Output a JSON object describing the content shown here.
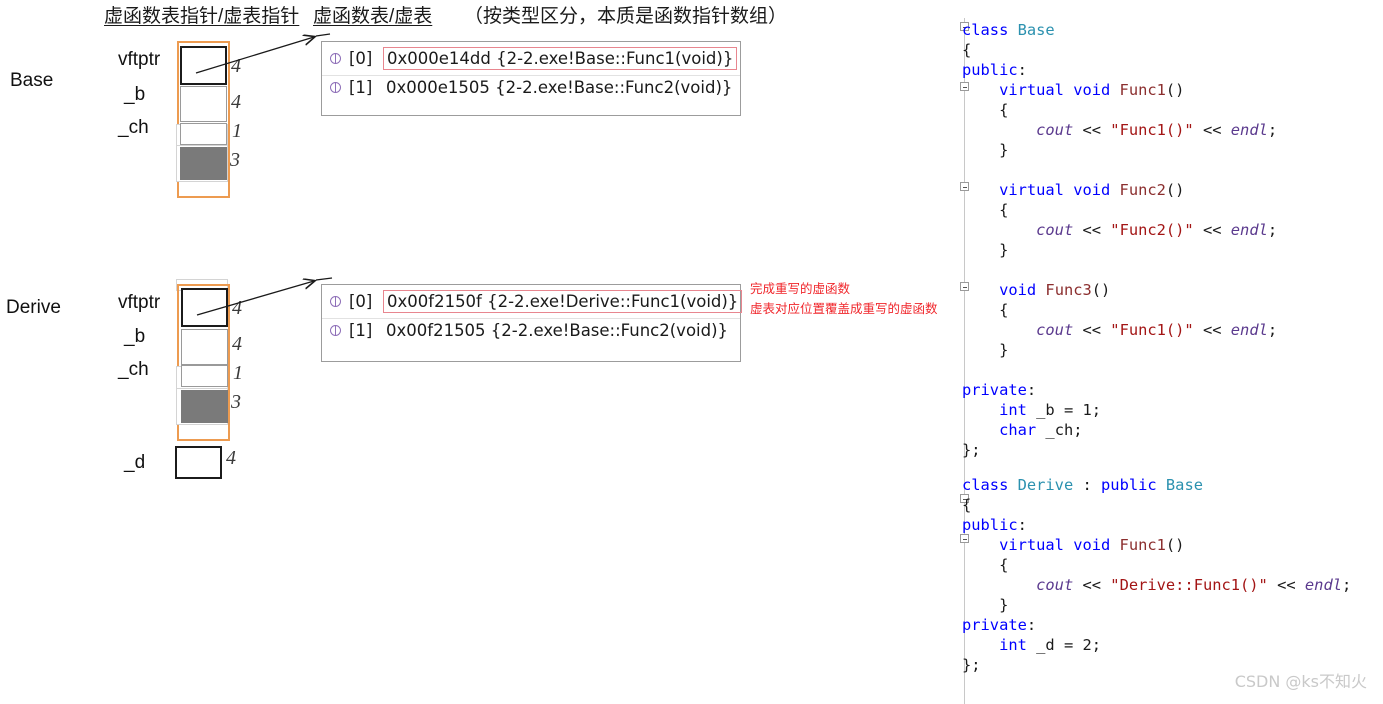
{
  "headings": {
    "vfptr_label": "虚函数表指针/虚表指针",
    "vftable_label": "虚函数表/虚表",
    "note": "（按类型区分，本质是函数指针数组）"
  },
  "objects": [
    {
      "class_name": "Base",
      "members": [
        {
          "name": "vftptr",
          "size": "4"
        },
        {
          "name": "_b",
          "size": "4"
        },
        {
          "name": "_ch",
          "size": "1"
        },
        {
          "name": "",
          "size": "3"
        }
      ]
    },
    {
      "class_name": "Derive",
      "members": [
        {
          "name": "vftptr",
          "size": "4"
        },
        {
          "name": "_b",
          "size": "4"
        },
        {
          "name": "_ch",
          "size": "1"
        },
        {
          "name": "",
          "size": "3"
        },
        {
          "name": "_d",
          "size": "4"
        }
      ]
    }
  ],
  "vtables": [
    {
      "owner": "Base",
      "rows": [
        {
          "index": "[0]",
          "value": "0x000e14dd {2-2.exe!Base::Func1(void)}",
          "highlighted": true
        },
        {
          "index": "[1]",
          "value": "0x000e1505 {2-2.exe!Base::Func2(void)}",
          "highlighted": false
        }
      ]
    },
    {
      "owner": "Derive",
      "rows": [
        {
          "index": "[0]",
          "value": "0x00f2150f {2-2.exe!Derive::Func1(void)}",
          "highlighted": true
        },
        {
          "index": "[1]",
          "value": "0x00f21505 {2-2.exe!Base::Func2(void)}",
          "highlighted": false
        }
      ]
    }
  ],
  "annotations": {
    "red_line1": "完成重写的虚函数",
    "red_line2": "虚表对应位置覆盖成重写的虚函数"
  },
  "code": {
    "base_class": [
      [
        {
          "t": "class ",
          "c": "kw"
        },
        {
          "t": "Base",
          "c": "ty"
        }
      ],
      [
        {
          "t": "{",
          "c": "pl"
        }
      ],
      [
        {
          "t": "public",
          "c": "kw"
        },
        {
          "t": ":",
          "c": "pl"
        }
      ],
      [
        {
          "t": "    ",
          "c": "pl"
        },
        {
          "t": "virtual void ",
          "c": "kw"
        },
        {
          "t": "Func1",
          "c": "fn"
        },
        {
          "t": "()",
          "c": "pl"
        }
      ],
      [
        {
          "t": "    {",
          "c": "pl"
        }
      ],
      [
        {
          "t": "        ",
          "c": "pl"
        },
        {
          "t": "cout",
          "c": "obj"
        },
        {
          "t": " << ",
          "c": "pl"
        },
        {
          "t": "\"Func1()\"",
          "c": "str"
        },
        {
          "t": " << ",
          "c": "pl"
        },
        {
          "t": "endl",
          "c": "obj"
        },
        {
          "t": ";",
          "c": "pl"
        }
      ],
      [
        {
          "t": "    }",
          "c": "pl"
        }
      ],
      [
        {
          "t": "",
          "c": "pl"
        }
      ],
      [
        {
          "t": "    ",
          "c": "pl"
        },
        {
          "t": "virtual void ",
          "c": "kw"
        },
        {
          "t": "Func2",
          "c": "fn"
        },
        {
          "t": "()",
          "c": "pl"
        }
      ],
      [
        {
          "t": "    {",
          "c": "pl"
        }
      ],
      [
        {
          "t": "        ",
          "c": "pl"
        },
        {
          "t": "cout",
          "c": "obj"
        },
        {
          "t": " << ",
          "c": "pl"
        },
        {
          "t": "\"Func2()\"",
          "c": "str"
        },
        {
          "t": " << ",
          "c": "pl"
        },
        {
          "t": "endl",
          "c": "obj"
        },
        {
          "t": ";",
          "c": "pl"
        }
      ],
      [
        {
          "t": "    }",
          "c": "pl"
        }
      ],
      [
        {
          "t": "",
          "c": "pl"
        }
      ],
      [
        {
          "t": "    ",
          "c": "pl"
        },
        {
          "t": "void ",
          "c": "kw"
        },
        {
          "t": "Func3",
          "c": "fn"
        },
        {
          "t": "()",
          "c": "pl"
        }
      ],
      [
        {
          "t": "    {",
          "c": "pl"
        }
      ],
      [
        {
          "t": "        ",
          "c": "pl"
        },
        {
          "t": "cout",
          "c": "obj"
        },
        {
          "t": " << ",
          "c": "pl"
        },
        {
          "t": "\"Func1()\"",
          "c": "str"
        },
        {
          "t": " << ",
          "c": "pl"
        },
        {
          "t": "endl",
          "c": "obj"
        },
        {
          "t": ";",
          "c": "pl"
        }
      ],
      [
        {
          "t": "    }",
          "c": "pl"
        }
      ],
      [
        {
          "t": "",
          "c": "pl"
        }
      ],
      [
        {
          "t": "private",
          "c": "kw"
        },
        {
          "t": ":",
          "c": "pl"
        }
      ],
      [
        {
          "t": "    ",
          "c": "pl"
        },
        {
          "t": "int ",
          "c": "kw"
        },
        {
          "t": "_b = 1;",
          "c": "pl"
        }
      ],
      [
        {
          "t": "    ",
          "c": "pl"
        },
        {
          "t": "char ",
          "c": "kw"
        },
        {
          "t": "_ch;",
          "c": "pl"
        }
      ],
      [
        {
          "t": "};",
          "c": "pl"
        }
      ]
    ],
    "derive_class": [
      [
        {
          "t": "class ",
          "c": "kw"
        },
        {
          "t": "Derive",
          "c": "ty"
        },
        {
          "t": " : ",
          "c": "pl"
        },
        {
          "t": "public ",
          "c": "kw"
        },
        {
          "t": "Base",
          "c": "ty"
        }
      ],
      [
        {
          "t": "{",
          "c": "pl"
        }
      ],
      [
        {
          "t": "public",
          "c": "kw"
        },
        {
          "t": ":",
          "c": "pl"
        }
      ],
      [
        {
          "t": "    ",
          "c": "pl"
        },
        {
          "t": "virtual void ",
          "c": "kw"
        },
        {
          "t": "Func1",
          "c": "fn"
        },
        {
          "t": "()",
          "c": "pl"
        }
      ],
      [
        {
          "t": "    {",
          "c": "pl"
        }
      ],
      [
        {
          "t": "        ",
          "c": "pl"
        },
        {
          "t": "cout",
          "c": "obj"
        },
        {
          "t": " << ",
          "c": "pl"
        },
        {
          "t": "\"Derive::Func1()\"",
          "c": "str"
        },
        {
          "t": " << ",
          "c": "pl"
        },
        {
          "t": "endl",
          "c": "obj"
        },
        {
          "t": ";",
          "c": "pl"
        }
      ],
      [
        {
          "t": "    }",
          "c": "pl"
        }
      ],
      [
        {
          "t": "private",
          "c": "kw"
        },
        {
          "t": ":",
          "c": "pl"
        }
      ],
      [
        {
          "t": "    ",
          "c": "pl"
        },
        {
          "t": "int ",
          "c": "kw"
        },
        {
          "t": "_d = 2;",
          "c": "pl"
        }
      ],
      [
        {
          "t": "};",
          "c": "pl"
        }
      ]
    ]
  },
  "watermark": "CSDN @ks不知火"
}
